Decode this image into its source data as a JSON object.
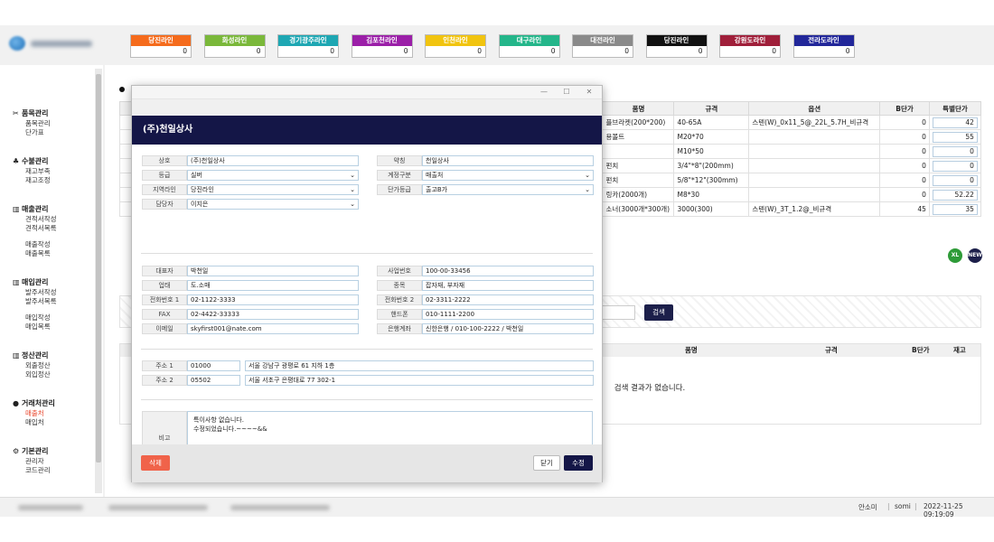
{
  "lines": [
    {
      "label": "당진라인",
      "count": "0",
      "color": "#f56b1c"
    },
    {
      "label": "화성라인",
      "count": "0",
      "color": "#7ab83a"
    },
    {
      "label": "경기광주라인",
      "count": "0",
      "color": "#1ea7b3"
    },
    {
      "label": "김포천라인",
      "count": "0",
      "color": "#9b1fa8"
    },
    {
      "label": "인천라인",
      "count": "0",
      "color": "#f1c40f"
    },
    {
      "label": "대구라인",
      "count": "0",
      "color": "#24b68a"
    },
    {
      "label": "대전라인",
      "count": "0",
      "color": "#8a8a8a"
    },
    {
      "label": "당진라인",
      "count": "0",
      "color": "#111111"
    },
    {
      "label": "강원도라인",
      "count": "0",
      "color": "#a01f3a"
    },
    {
      "label": "전라도라인",
      "count": "0",
      "color": "#22279a"
    }
  ],
  "menu": [
    {
      "title": "품목관리",
      "icon": "✂",
      "items": [
        "품목관리",
        "단가표"
      ]
    },
    {
      "title": "수불관리",
      "icon": "♣",
      "items": [
        "재고부족",
        "재고조정"
      ]
    },
    {
      "title": "매출관리",
      "icon": "▥",
      "items": [
        "견적서작성",
        "견적서목록",
        "",
        "매출작성",
        "매출목록"
      ]
    },
    {
      "title": "매입관리",
      "icon": "▥",
      "items": [
        "발주서작성",
        "발주서목록",
        "",
        "매입작성",
        "매입목록"
      ]
    },
    {
      "title": "정산관리",
      "icon": "▥",
      "items": [
        "외출정산",
        "외입정산"
      ]
    },
    {
      "title": "거래처관리",
      "icon": "●",
      "items": [
        "매출처",
        "매입처"
      ]
    },
    {
      "title": "기본관리",
      "icon": "⚙",
      "items": [
        "관리자",
        "코드관리"
      ]
    }
  ],
  "table": {
    "headers": [
      "품명",
      "규격",
      "옵션",
      "B단가",
      "특별단가"
    ],
    "rows": [
      {
        "name": "플브라켓(200*200)",
        "spec": "40-65A",
        "option": "스텐(W)_0x11_5@_22L_5.7H_비규격",
        "b": "0",
        "special": "42"
      },
      {
        "name": "용볼트",
        "spec": "M20*70",
        "option": "",
        "b": "0",
        "special": "55"
      },
      {
        "name": "",
        "spec": "M10*50",
        "option": "",
        "b": "0",
        "special": "0"
      },
      {
        "name": "펀치",
        "spec": "3/4\"*8\"(200mm)",
        "option": "",
        "b": "0",
        "special": "0"
      },
      {
        "name": "펀치",
        "spec": "5/8\"*12\"(300mm)",
        "option": "",
        "b": "0",
        "special": "0"
      },
      {
        "name": "링카(2000개)",
        "spec": "M8*30",
        "option": "",
        "b": "0",
        "special": "52.22"
      },
      {
        "name": "소너(3000개*300개)",
        "spec": "3000(300)",
        "option": "스텐(W)_3T_1.2@_비규격",
        "b": "45",
        "special": "35"
      }
    ]
  },
  "xl_label": "XL",
  "new_label": "NEW",
  "search_label": "검색",
  "result": {
    "headers": [
      "품명",
      "규격",
      "B단가",
      "재고"
    ],
    "empty": "검색 결과가 없습니다."
  },
  "status": {
    "user": "안소미",
    "id": "somi",
    "datetime": "2022-11-25 09:19:09"
  },
  "modal": {
    "title": "(주)천일상사",
    "left1": [
      {
        "label": "상호",
        "value": "(주)천일상사",
        "select": false
      },
      {
        "label": "등급",
        "value": "실버",
        "select": true
      },
      {
        "label": "지역라인",
        "value": "당진라인",
        "select": true
      },
      {
        "label": "담당자",
        "value": "이지은",
        "select": true
      }
    ],
    "right1": [
      {
        "label": "약칭",
        "value": "천일상사",
        "select": false
      },
      {
        "label": "계정구분",
        "value": "매출처",
        "select": true
      },
      {
        "label": "단가등급",
        "value": "출고B가",
        "select": true
      }
    ],
    "left2": [
      {
        "label": "대표자",
        "value": "박천일"
      },
      {
        "label": "업태",
        "value": "도.소매"
      },
      {
        "label": "전화번호 1",
        "value": "02-1122-3333"
      },
      {
        "label": "FAX",
        "value": "02-4422-33333"
      },
      {
        "label": "이메일",
        "value": "skyfirst001@nate.com"
      }
    ],
    "right2": [
      {
        "label": "사업번호",
        "value": "100-00-33456"
      },
      {
        "label": "종목",
        "value": "잡자재, 부자재"
      },
      {
        "label": "전화번호 2",
        "value": "02-3311-2222"
      },
      {
        "label": "핸드폰",
        "value": "010-1111-2200"
      },
      {
        "label": "은행계좌",
        "value": "신한은행 / 010-100-2222 / 박천일"
      }
    ],
    "addr": [
      {
        "label": "주소 1",
        "zip": "01000",
        "address": "서울 강남구 광평로 61 지하 1층"
      },
      {
        "label": "주소 2",
        "zip": "05502",
        "address": "서울 서초구 은평대로 77 302-1"
      }
    ],
    "memo_label": "비고",
    "memo_line1": "특이사항 없습니다.",
    "memo_line2": "수정되었습니다.~~~~&&",
    "delete_label": "삭제",
    "close_label": "닫기",
    "edit_label": "수정"
  }
}
